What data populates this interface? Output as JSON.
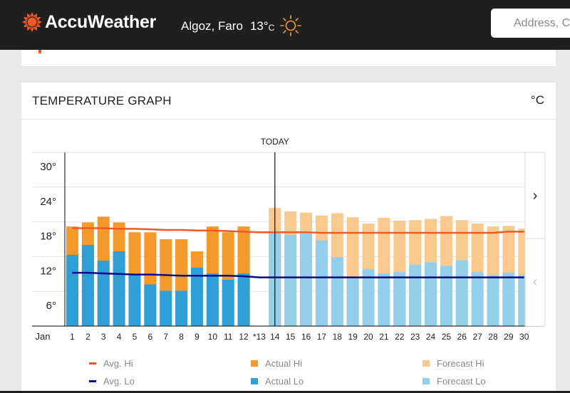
{
  "header": {
    "brand": "AccuWeather",
    "location": "Algoz, Faro",
    "current_temp": "13°",
    "current_unit": "C",
    "weather_icon": "sun-icon",
    "search_placeholder": "Address, City or Zip"
  },
  "card": {
    "title": "TEMPERATURE GRAPH",
    "unit_toggle": "°C"
  },
  "colors": {
    "brand_orange": "#f15a24",
    "avg_hi": "#f15a24",
    "avg_lo": "#0a0a8c",
    "actual_hi": "#f59a2a",
    "actual_lo": "#2e9fd8",
    "forecast_hi": "#f9c98e",
    "forecast_lo": "#93ceeb"
  },
  "chart_data": {
    "type": "bar",
    "title": "TEMPERATURE GRAPH",
    "month_label": "Jan",
    "today_label": "TODAY",
    "today_day": 14,
    "ylim": [
      0,
      30
    ],
    "yticks": [
      6,
      12,
      18,
      24,
      30
    ],
    "ytick_labels": [
      "6°",
      "12°",
      "18°",
      "24°",
      "30°"
    ],
    "grid": true,
    "days": [
      "1",
      "2",
      "3",
      "4",
      "5",
      "6",
      "7",
      "8",
      "9",
      "10",
      "11",
      "12",
      "*13",
      "14",
      "15",
      "16",
      "17",
      "18",
      "19",
      "20",
      "21",
      "22",
      "23",
      "24",
      "25",
      "26",
      "27",
      "28",
      "29",
      "30"
    ],
    "series": [
      {
        "name": "Actual Hi",
        "kind": "actual",
        "values": [
          17.2,
          17.9,
          18.9,
          17.9,
          16.2,
          16.2,
          15.0,
          15.0,
          12.9,
          17.2,
          16.2,
          17.2,
          null,
          null,
          null,
          null,
          null,
          null,
          null,
          null,
          null,
          null,
          null,
          null,
          null,
          null,
          null,
          null,
          null,
          null
        ]
      },
      {
        "name": "Actual Lo",
        "kind": "actual",
        "values": [
          12.3,
          14.0,
          11.3,
          12.9,
          9.0,
          7.2,
          6.1,
          6.1,
          10.1,
          9.1,
          8.0,
          9.1,
          null,
          null,
          null,
          null,
          null,
          null,
          null,
          null,
          null,
          null,
          null,
          null,
          null,
          null,
          null,
          null,
          null,
          null
        ]
      },
      {
        "name": "Forecast Hi",
        "kind": "forecast",
        "values": [
          null,
          null,
          null,
          null,
          null,
          null,
          null,
          null,
          null,
          null,
          null,
          null,
          null,
          20.4,
          19.8,
          19.6,
          19.1,
          19.5,
          18.8,
          17.7,
          18.7,
          18.2,
          18.3,
          18.5,
          19.0,
          18.3,
          17.7,
          17.2,
          17.3,
          16.8
        ]
      },
      {
        "name": "Forecast Lo",
        "kind": "forecast",
        "values": [
          null,
          null,
          null,
          null,
          null,
          null,
          null,
          null,
          null,
          null,
          null,
          null,
          null,
          16.0,
          15.7,
          16.0,
          14.8,
          11.9,
          8.3,
          9.8,
          9.1,
          9.3,
          10.6,
          11.0,
          10.4,
          11.4,
          9.3,
          8.8,
          9.2,
          8.8
        ]
      },
      {
        "name": "Avg. Hi",
        "kind": "line",
        "values": [
          16.9,
          16.9,
          16.9,
          16.8,
          16.8,
          16.7,
          16.6,
          16.6,
          16.5,
          16.5,
          16.4,
          16.3,
          16.2,
          16.2,
          16.2,
          16.2,
          16.1,
          16.1,
          16.1,
          16.1,
          16.1,
          16.1,
          16.1,
          16.1,
          16.1,
          16.1,
          16.1,
          16.1,
          16.3,
          16.3
        ]
      },
      {
        "name": "Avg. Lo",
        "kind": "line",
        "values": [
          9.2,
          9.2,
          9.1,
          9.0,
          8.9,
          8.9,
          8.8,
          8.7,
          8.7,
          8.7,
          8.7,
          8.6,
          8.4,
          8.4,
          8.4,
          8.4,
          8.4,
          8.4,
          8.4,
          8.4,
          8.4,
          8.4,
          8.4,
          8.4,
          8.4,
          8.4,
          8.4,
          8.4,
          8.4,
          8.4
        ]
      }
    ],
    "legend": [
      {
        "label": "Avg. Hi",
        "type": "line",
        "color": "#f15a24"
      },
      {
        "label": "Avg. Lo",
        "type": "line",
        "color": "#0a0a8c"
      },
      {
        "label": "Actual Hi",
        "type": "box",
        "color": "#f59a2a"
      },
      {
        "label": "Actual Lo",
        "type": "box",
        "color": "#2e9fd8"
      },
      {
        "label": "Forecast Hi",
        "type": "box",
        "color": "#f9c98e"
      },
      {
        "label": "Forecast Lo",
        "type": "box",
        "color": "#93ceeb"
      }
    ],
    "legend_position": "bottom",
    "nav": {
      "next": "›",
      "prev": "‹"
    }
  }
}
